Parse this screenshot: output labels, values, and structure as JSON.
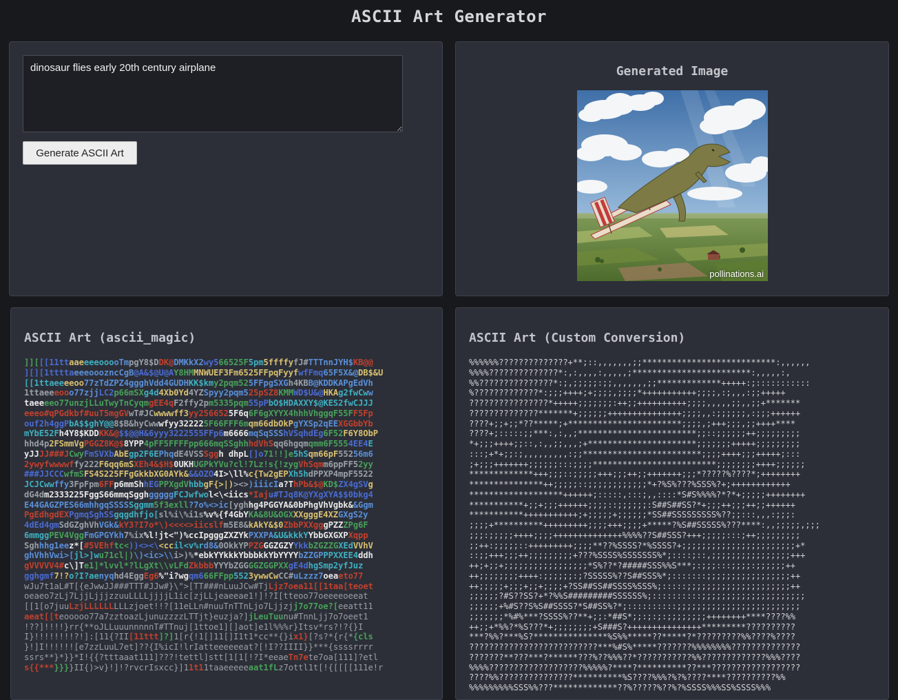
{
  "app": {
    "title": "ASCII Art Generator"
  },
  "input": {
    "prompt_value": "dinosaur flies early 20th century airplane",
    "generate_label": "Generate ASCII Art"
  },
  "image_panel": {
    "heading": "Generated Image",
    "watermark": "pollinations.ai",
    "image_description_icon": "dinosaur-airplane-image"
  },
  "ascii_magic": {
    "heading": "ASCII Art (ascii_magic)",
    "lines": [
      "]][[[11ttaaeeeeooooTmpgY8$DDK@DMKkX2wy566525F5pm5ffffyfJ#TTTnnJYH$KB@@",
      "][][1ttttaeeeooozncCgB@A&$@U@AY8HMMNWUEF3Fm6525FFpqFyyfwfFmq65F5X&@DB$&U",
      "[[1ttaeeeeoo77zTdZPZ4ggghVdd4GUDHKK$kmy2pqm525FFpgSXGh4KBB@KDDKAPgEdVh",
      "1ttaeeeooo77zjjLC2p66mSXg4d4Xb0Yd4YZSpyy2pqm525pSZ8KMMWD$U&@HKAg2fwCww",
      "taeeeeo77unzjLLuTwyTnCyqmgEE4qF2ffy2pm5335pqm55pPbO$HDAXXY$@KES2fwCJJJ",
      "eeeo#qPGdkbf#uuT5mgGVwT#JCwwwwff3yy2566525F6q6F6gXYYX4hhhVhggqF55FF5Fp",
      "ouf2h4ggPbA$$ghY@@8$B&hyCwwwfyy322225F66FFF6mqm66dbOkPgYXSp2qEEXGGbbYb",
      "mYbE52Fh4Y8$KDDKK&@$$@@H&6yyy3222555FFp6m6666mqSqSSShVSqhdEg6F52F6Y8ObP",
      "hhd4p2FSmmVgPGGZ8K@$8YPP4pFF5FFFFpp666mqSSghhhdVhSqq6hgqmqmm6F5554EE4E",
      "yJJJJ###JCwyFmSVXbAbEgp2F6EPhqdE4VSSSggh dhpL[]o71!!]e5hSqm66pF55256m6",
      "2ywyfwwwwffy222F6qq6mSXEh4&$H$0UKHUGPkYVu?cl!7Lz!s{!zygVhSqmm6ppFF52yy",
      "###JJCCCwfmSFS4S225FFgGkkbXG0AYk&&&OZO4I>\\ll%c{Tw2gEPXh5hdPPXP4mpF5522",
      "JCJCwwffy3FpFpm6FFp6mmShhEGPPXgdVhbbgF{>|)><>)iiicIa?ThPb&$@KD$ZX4gSVg",
      "dG4dm2333225FggS66mmqSgghgggggFCJwfwol<\\<iics*Iaju#TJq8K@YXgXYA$$0bkg4",
      "E44GAGZPES66mhhgqSSSSSggmm5f3exll?7o%<>ic[yghhg4PGGYA&0bPhgVhVgbk&&Ggm",
      "PgEdhgdEXPgmqSghSSgqgdhfjo[sl%i\\%i1s%v%{f4GbYKA&8U&OGXXXgggE4XZGXgS2y",
      "4dEd4gmSdGZghVhVGk&kY3?I7o*\\)<<<<>iicslfm5E8&kAkY&$0ZbbPXXgggPZZZPg6F",
      "6mmggPEV4VggFmGPGYkh7%ix%l!jt<\")%ccIpgggZXZYkPXXPA&U&kkkYYbbGXGXPXqpp",
      "Sghhhg1eez*[#5VEhftc<))<><\\<ccil<v%rd8&0OkkYPPZGGGZGZYYkkbZGZZGXEdVVhV",
      "ghVhhVwi>[jl>]wu71cl|)\\)<ic>\\\\i>)%*ebkYYkkkYbbbkkYbYYYYbZZGPPPXXEE4ddh",
      "gVVVVV4#c\\]Te1]*lvvl*?lLgXt\\\\vLFdZkbbbYYYbZGGGGZGGPXXgE4dhgSmp2yfJuz",
      "gghgmf7!?o?I?aenyqhd4EggEg6%\"i?wgqm666FFpp5523ywwCwCC#uLzzz7oeaeto77",
      "wJu7t1aL#T[{eJwwJJ###TTT#JJw#}\\\">[TT###nLuuJCw#TjLjz7oea11[[1taa[teoet",
      "oeaeo7zLj7LjjLjjjzzuuLLLLjjjjL1ic[zjLLjeaeeae1!]!?I[tteoo77oeeeeoeeat",
      "[[1[o7juuLzjLLLLLLLLLzjoet!!?[11eLLn#nuuTnTTnLjo7Ljjzjj7o77oe?[eeatt11",
      "aeat[[teooooo77a7zztoazLjunuzzzzLTTjt}euzja?]jLeuTuunu#TnnLjj7o7oeet1",
      "!??]!!!!}rr{**oJLLuuunnnnnT#TTnuj[1ttoe1][]aot]e1l%%%r}Itsv*rs?!?{}I",
      "I}!!!!!!!!?!]:[11{?II[11ttt]?]1[r{!1[]11[]I1t1*cc**{}ix1}[?s?*{r{*{cls",
      "}!]I!!!!!![e7zzLuuL7et]??{I%icI!lrIatteeeeeeat?[!I??IIII}}***{ssssrrrr",
      "ssrs**}*}}*I!{{?tttaaat111]???!tettl]stt[1[1[!?I*eeaeTn7ete7oa[111]?etl",
      "s{{***}}}}II{)>v}!]!?rvcrIsxcc}]11t11taaeeeeeaat1fLz7ottl1t[!{[[[[111e!r"
    ]
  },
  "custom": {
    "heading": "ASCII Art (Custom Conversion)",
    "lines": [
      "%%%%%%??????????????+**;::,,,,,,,;;***************************:,,,,,,",
      "%%%%??????????????*:,:,,,,:,,,,,;************************:,,,,,:,",
      "%%???????????????*:;,;;;;;:;;,,,,,,,;;*************+++++:;:::::::::::",
      "%?????????????*:;;;++++;+;;;;,;;;;*+++++++++++;;;;,:;,,,:;;+++++",
      "????????????????*+++++;;;;;;;:++;;++++++++++;;;;,,,,,;;,,;;+*******",
      "??????????????*******+;;;;;;+++++++++++++++;;;;,,:;;;;;;,:;;;++++++",
      "????+;;+;;*??*****;+***********************;;;;,;+++;;;,;;++++****",
      "????+;:::::;;***:,:,,;************************;;::;;;;;;++;;;;;;;;;",
      "*+;;;++++;;::,:,,;;,,,;+**********************;;;;;;;+++++;;;;;;;;;",
      ":::;+*+;;:;,,,,,,,,,:;;************************;;;;++++;;;+++++;:::",
      ";+;;;+++++++;;;;;;:::;;;;*************************;;;;;;;;++++;;;;;;",
      "*************+++;;;::;;;;;+++;;;++;;+++++++;;;*?????%????*;++++++++",
      "***************++;;;;;::;;;;;;;;;;;;*+?%S%???%SSS%?+;++++++++++++",
      "*******************++++++;:::::,:::;,,::::*S#S%%%%?*?*+;;;;;++++++++",
      "***********+;;+;;;++++++;;;;::;;;;;;:S##S##SS?*+;;;++;;;++;;++++++",
      "***********+++++++++++;+;;;;;+;;;;;;*SS##SSSSSSSSS%??;;:::,,,:;;;:",
      ";;;;+**********+++++++++;;;;+++;;;;+*****?%S##SSSSS%???****:,,;;;;;,;;;",
      ";;;:;;;;;++++;;;;++++++++++++++%%%%??S##SSS?+++;;;;;:::;++;;;;;;;;;",
      ";;++:;;;;;::+++++++++;;;;**??%SSSS?*%SSSS?+;;;;;;;;;;;;;;;;;;;;;;;+*",
      "::;;+++;;;++;;;;;;;;;+???%SSSS%SSSSSSS%*;::::;::,;;;;;;;;;;;;;;;;+++",
      "++;+;;+;;;;;;;;;;;;;;;;;*S%??*?#####SSS%%S***;:;;;:::;;;;:;;;;;;++",
      "++;;;;;;;;++++:;;;;;;:;?SSSSS%??S##SSS%*;:::::::;;;;;;;;;;;;;;;;;++",
      "++;;;;;+;;;+;;+;;;;+?SS##SS##SSSS%SSS%;:::::;;;;;;;;;;;;;;;;;;;;;++",
      ";;;;;;?#S??SS?+*?%%S#########SSSSSS%;::::::::::;;;;;;;;;;;;;;;;;;;;;",
      ";;;;;;+%#S??S%S##SSSS?*S##SS%?*;::::::::::;;;;;;;;;;;;;;;;;;;;;;;;;",
      ";;;;;;;*%#%***?SSSS%??**+;;:*##S*;;:;:;:;;;;;;;;++++++++****????%%",
      "++;;+*%%?*%S???*+;;;;;;;;+S###S?+++++++++++++++*********??????????",
      "***?%%?***%S?***************%S%%*****??*****?*?????????%%????%????",
      "??????????????????????????***%#S%*****???????%%%%%%%%??????????????",
      "???????**???***?******???%??%%%??*???????????%%?????????????%%%????",
      "%%%%???????????????????%%%%%?****?**********??***??????????????????",
      "????%%???????????????**********%S????%%%?%?%????****??????????%%",
      "%%%%%%%%%SSS%%???*************??%?????%??%?%SSSS%%%SS%SSSS%%%"
    ]
  }
}
